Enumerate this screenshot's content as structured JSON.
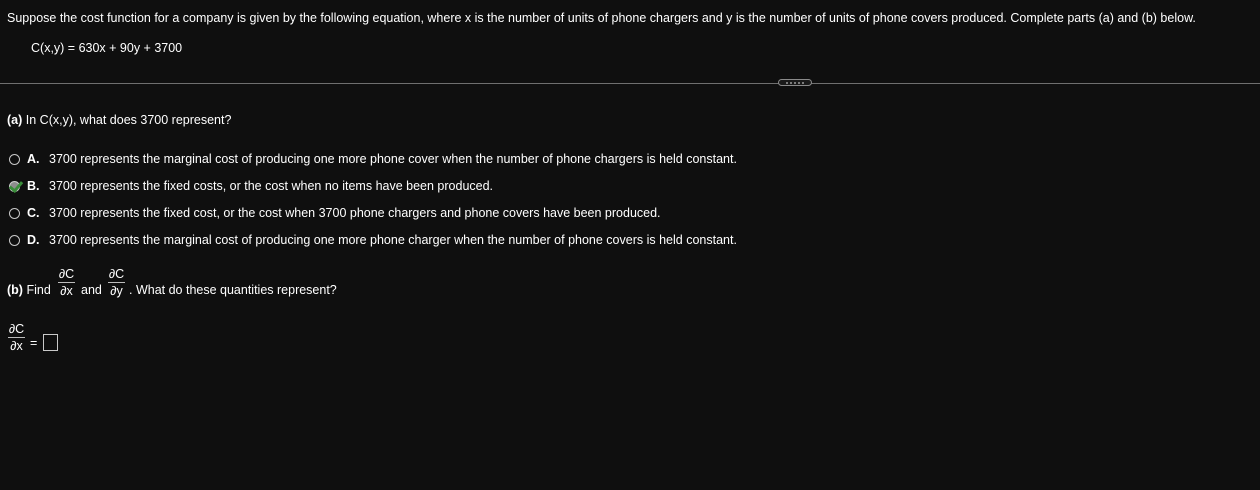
{
  "question": {
    "intro": "Suppose the cost function for a company is given by the following equation, where x is the number of units of phone chargers and y is the number of units of phone covers produced. Complete parts (a) and (b) below.",
    "equation": "C(x,y) = 630x + 90y + 3700"
  },
  "part_a": {
    "label": "(a)",
    "prompt": "In C(x,y), what does 3700 represent?",
    "choices": [
      {
        "letter": "A.",
        "text": "3700 represents the marginal cost of producing one more phone cover when the number of phone chargers is held constant.",
        "selected": false
      },
      {
        "letter": "B.",
        "text": "3700 represents the fixed costs, or the cost when no items have been produced.",
        "selected": true
      },
      {
        "letter": "C.",
        "text": "3700 represents the fixed cost, or the cost when 3700 phone chargers and phone covers have been produced.",
        "selected": false
      },
      {
        "letter": "D.",
        "text": "3700 represents the marginal cost of producing one more phone charger when the number of phone covers is held constant.",
        "selected": false
      }
    ]
  },
  "part_b": {
    "label": "(b)",
    "find_word": "Find",
    "and_word": "and",
    "tail": ". What do these quantities represent?",
    "frac_x": {
      "num": "∂C",
      "den": "∂x"
    },
    "frac_y": {
      "num": "∂C",
      "den": "∂y"
    },
    "answer_lhs": {
      "num": "∂C",
      "den": "∂x"
    },
    "equals": "=",
    "answer_value": ""
  },
  "icons": {
    "radio": "radio-button-icon",
    "check": "green-check-icon",
    "divider_handle": "ellipsis-handle-icon"
  },
  "colors": {
    "background": "#0f0f0f",
    "text": "#ffffff",
    "check": "#3a8d3a"
  }
}
